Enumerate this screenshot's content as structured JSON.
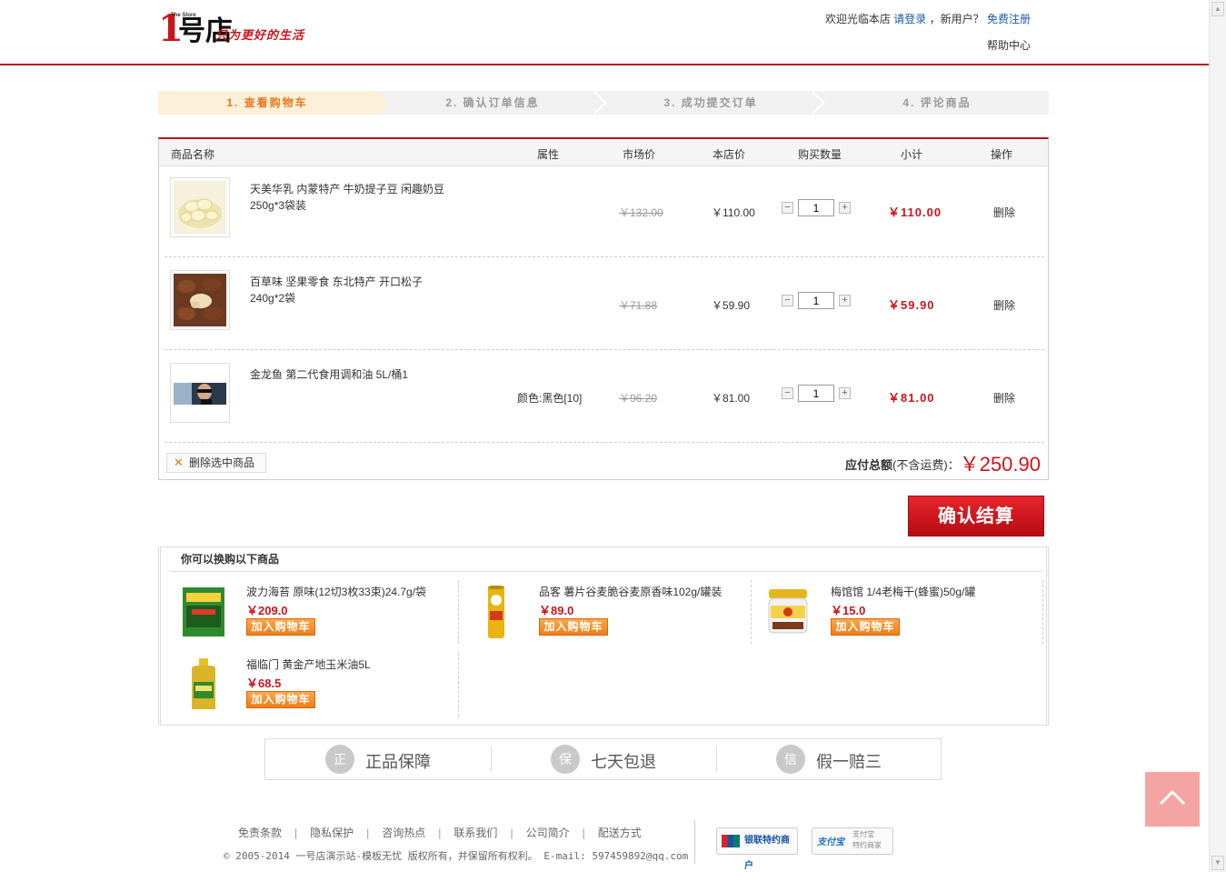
{
  "header": {
    "logo_num": "1",
    "logo_store": "号店",
    "logo_thestore": "The Store",
    "slogan": "只为更好的生活",
    "welcome": "欢迎光临本店",
    "login": "请登录",
    "new_user": "，新用户？",
    "register": "免费注册",
    "help": "帮助中心"
  },
  "steps": [
    {
      "label": "1. 查看购物车",
      "active": true
    },
    {
      "label": "2. 确认订单信息",
      "active": false
    },
    {
      "label": "3. 成功提交订单",
      "active": false
    },
    {
      "label": "4. 评论商品",
      "active": false
    }
  ],
  "cart": {
    "headers": {
      "name": "商品名称",
      "attr": "属性",
      "market_price": "市场价",
      "price": "本店价",
      "qty": "购买数量",
      "subtotal": "小计",
      "op": "操作"
    },
    "items": [
      {
        "name": "天美华乳 内蒙特产 牛奶提子豆 闲趣奶豆 250g*3袋装",
        "attr": "",
        "market_price": "￥132.00",
        "price": "￥110.00",
        "qty": "1",
        "subtotal": "￥110.00",
        "op": "删除"
      },
      {
        "name": "百草味 坚果零食 东北特产 开口松子 240g*2袋",
        "attr": "",
        "market_price": "￥71.88",
        "price": "￥59.90",
        "qty": "1",
        "subtotal": "￥59.90",
        "op": "删除"
      },
      {
        "name": "金龙鱼 第二代食用调和油 5L/桶1",
        "attr": "颜色:黑色[10]",
        "market_price": "￥96.20",
        "price": "￥81.00",
        "qty": "1",
        "subtotal": "￥81.00",
        "op": "删除"
      }
    ],
    "qty_minus": "−",
    "qty_plus": "+",
    "delete_selected": "删除选中商品",
    "total_label": "应付总额",
    "total_note": "(不含运费)：",
    "total_amount": "￥250.90"
  },
  "checkout_label": "确认结算",
  "recommend": {
    "title": "你可以换购以下商品",
    "items": [
      {
        "name": "波力海苔 原味(12切3枚33束)24.7g/袋",
        "price": "￥209.0",
        "button": "加入购物车"
      },
      {
        "name": "品客 薯片谷麦脆谷麦原香味102g/罐装",
        "price": "￥89.0",
        "button": "加入购物车"
      },
      {
        "name": "梅馆馆 1/4老梅干(蜂蜜)50g/罐",
        "price": "￥15.0",
        "button": "加入购物车"
      },
      {
        "name": "福临门 黄金产地玉米油5L",
        "price": "￥68.5",
        "button": "加入购物车"
      }
    ]
  },
  "guarantees": [
    {
      "icon": "正",
      "label": "正品保障"
    },
    {
      "icon": "保",
      "label": "七天包退"
    },
    {
      "icon": "信",
      "label": "假一赔三"
    }
  ],
  "footer": {
    "links": [
      "免责条款",
      "隐私保护",
      "咨询热点",
      "联系我们",
      "公司简介",
      "配送方式"
    ],
    "link_sep": "|",
    "copyright": "© 2005-2014 一号店演示站-模板无忧 版权所有，并保留所有权利。 E-mail: 597459892@qq.com",
    "badge1": "银联特约商户",
    "badge2_mark": "支付宝",
    "badge2_line1": "支付宝",
    "badge2_line2": "特约商家"
  },
  "colors": {
    "brand": "#b5121b",
    "accent": "#e8791f",
    "price": "#c8161d"
  }
}
